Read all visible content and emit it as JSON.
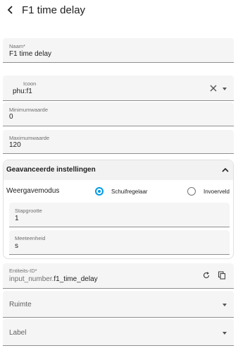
{
  "header": {
    "title": "F1 time delay"
  },
  "fields": {
    "name": {
      "label": "Naam*",
      "value": "F1 time delay"
    },
    "icon": {
      "label": "Icoon",
      "value": "phu:f1"
    },
    "min": {
      "label": "Minimumwaarde",
      "value": "0"
    },
    "max": {
      "label": "Maximumwaarde",
      "value": "120"
    }
  },
  "advanced": {
    "title": "Geavanceerde instellingen",
    "mode_label": "Weergavemodus",
    "options": [
      {
        "label": "Schuifregelaar",
        "selected": true
      },
      {
        "label": "Invoerveld",
        "selected": false
      }
    ],
    "step": {
      "label": "Stapgrootte",
      "value": "1"
    },
    "unit": {
      "label": "Meeteenheid",
      "value": "s"
    }
  },
  "entity": {
    "label": "Entiteits-ID*",
    "prefix": "input_number.",
    "value": "f1_time_delay"
  },
  "area": {
    "label": "Ruimte"
  },
  "tag": {
    "label": "Label"
  },
  "colors": {
    "accent": "#039be5",
    "field_bg": "#f5f5f5",
    "panel_head": "#f2f2f2"
  }
}
